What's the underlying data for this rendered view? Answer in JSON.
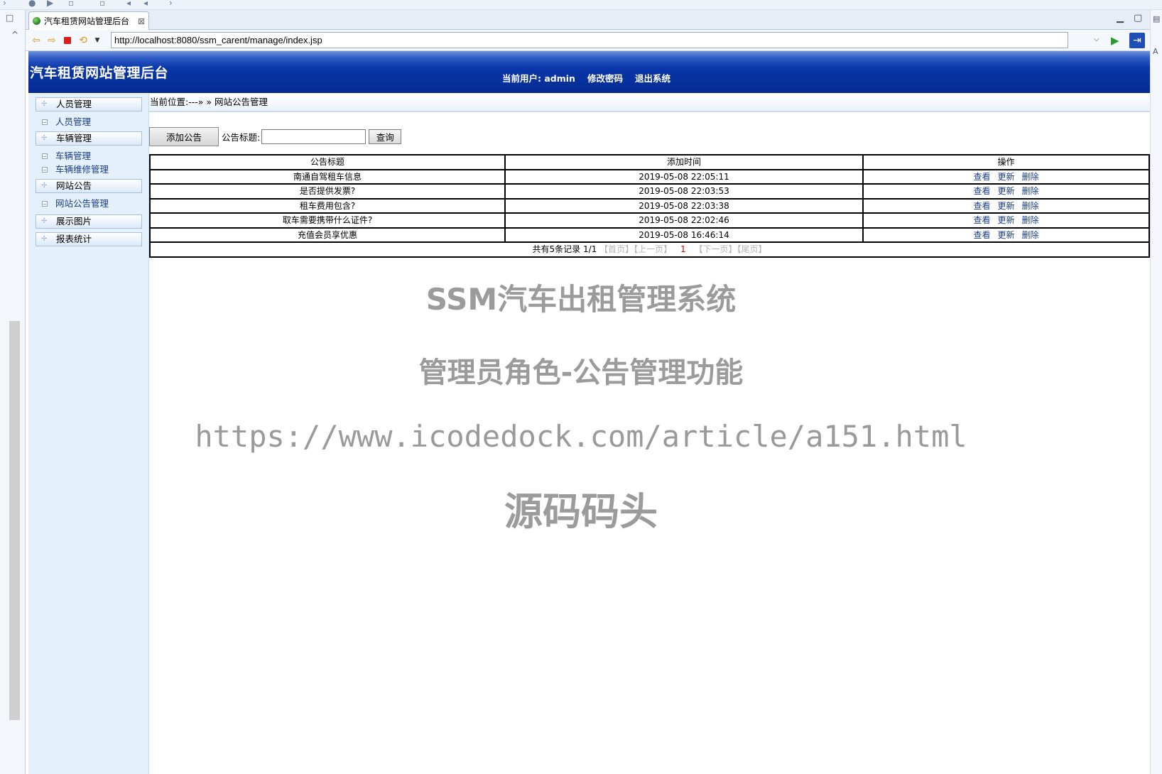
{
  "browser": {
    "tab_title": "汽车租赁网站管理后台",
    "tab_close_glyph": "⊠",
    "url": "http://localhost:8080/ssm_carent/manage/index.jsp"
  },
  "header": {
    "site_title": "汽车租赁网站管理后台",
    "current_user": "当前用户: admin",
    "change_password": "修改密码",
    "logout": "退出系统"
  },
  "sidebar": {
    "sections": [
      {
        "label": "人员管理",
        "links": [
          "人员管理"
        ]
      },
      {
        "label": "车辆管理",
        "links": [
          "车辆管理",
          "车辆维修管理"
        ]
      },
      {
        "label": "网站公告",
        "links": [
          "网站公告管理"
        ]
      },
      {
        "label": "展示图片",
        "links": []
      },
      {
        "label": "报表统计",
        "links": []
      }
    ]
  },
  "breadcrumb": "当前位置:---» » 网站公告管理",
  "search": {
    "add_button": "添加公告",
    "label": "公告标题:",
    "input_value": "",
    "query_button": "查询"
  },
  "table": {
    "headers": [
      "公告标题",
      "添加时间",
      "操作"
    ],
    "rows": [
      {
        "title": "南通自驾租车信息",
        "time": "2019-05-08 22:05:11"
      },
      {
        "title": "是否提供发票?",
        "time": "2019-05-08 22:03:53"
      },
      {
        "title": "租车费用包含?",
        "time": "2019-05-08 22:03:38"
      },
      {
        "title": "取车需要携带什么证件?",
        "time": "2019-05-08 22:02:46"
      },
      {
        "title": "充值会员享优惠",
        "time": "2019-05-08 16:46:14"
      }
    ],
    "actions": {
      "view": "查看",
      "update": "更新",
      "delete": "删除"
    },
    "pager": {
      "summary": "共有5条记录  1/1",
      "first": "【首页】",
      "prev": "【上一页】",
      "current": "1",
      "next": "【下一页】",
      "last": "【尾页】"
    }
  },
  "overlay": {
    "title": "SSM汽车出租管理系统",
    "subtitle": "管理员角色-公告管理功能",
    "url": "https://www.icodedock.com/article/a151.html",
    "brand": "源码码头"
  }
}
